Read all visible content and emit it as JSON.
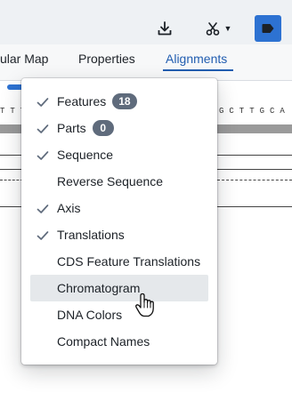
{
  "toolbar": {
    "download_icon": "download-icon",
    "scissors_icon": "scissors-icon",
    "tag_icon": "tag-icon",
    "accent": "#2d72d2"
  },
  "tabs": [
    {
      "label": "ular Map",
      "active": false
    },
    {
      "label": "Properties",
      "active": false
    },
    {
      "label": "Alignments",
      "active": true
    }
  ],
  "sequence": {
    "left_text": "T T T",
    "right_text": "G C T T G C A"
  },
  "menu": {
    "items": [
      {
        "label": "Features",
        "checked": true,
        "badge": "18"
      },
      {
        "label": "Parts",
        "checked": true,
        "badge": "0"
      },
      {
        "label": "Sequence",
        "checked": true
      },
      {
        "label": "Reverse Sequence",
        "checked": false
      },
      {
        "label": "Axis",
        "checked": true
      },
      {
        "label": "Translations",
        "checked": true
      },
      {
        "label": "CDS Feature Translations",
        "checked": false
      },
      {
        "label": "Chromatogram",
        "checked": false,
        "hovered": true
      },
      {
        "label": "DNA Colors",
        "checked": false
      },
      {
        "label": "Compact Names",
        "checked": false
      }
    ]
  }
}
